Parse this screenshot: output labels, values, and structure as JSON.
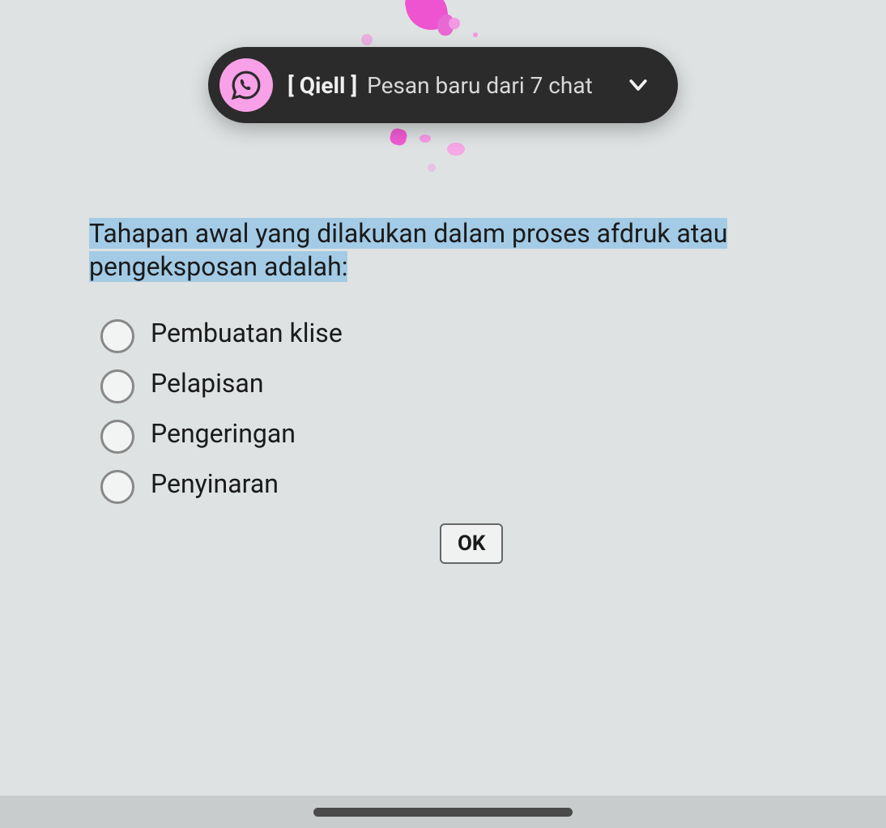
{
  "notification": {
    "sender": "[ Qiell ]",
    "message": "Pesan baru dari 7 chat",
    "icon": "whatsapp-icon",
    "accent_color": "#f8a0e8"
  },
  "question": {
    "text": "Tahapan awal yang dilakukan dalam proses afdruk atau pengeksposan adalah:"
  },
  "options": [
    {
      "label": "Pembuatan klise",
      "selected": false
    },
    {
      "label": "Pelapisan",
      "selected": false
    },
    {
      "label": "Pengeringan",
      "selected": false
    },
    {
      "label": "Penyinaran",
      "selected": false
    }
  ],
  "submit": {
    "label": "OK"
  }
}
